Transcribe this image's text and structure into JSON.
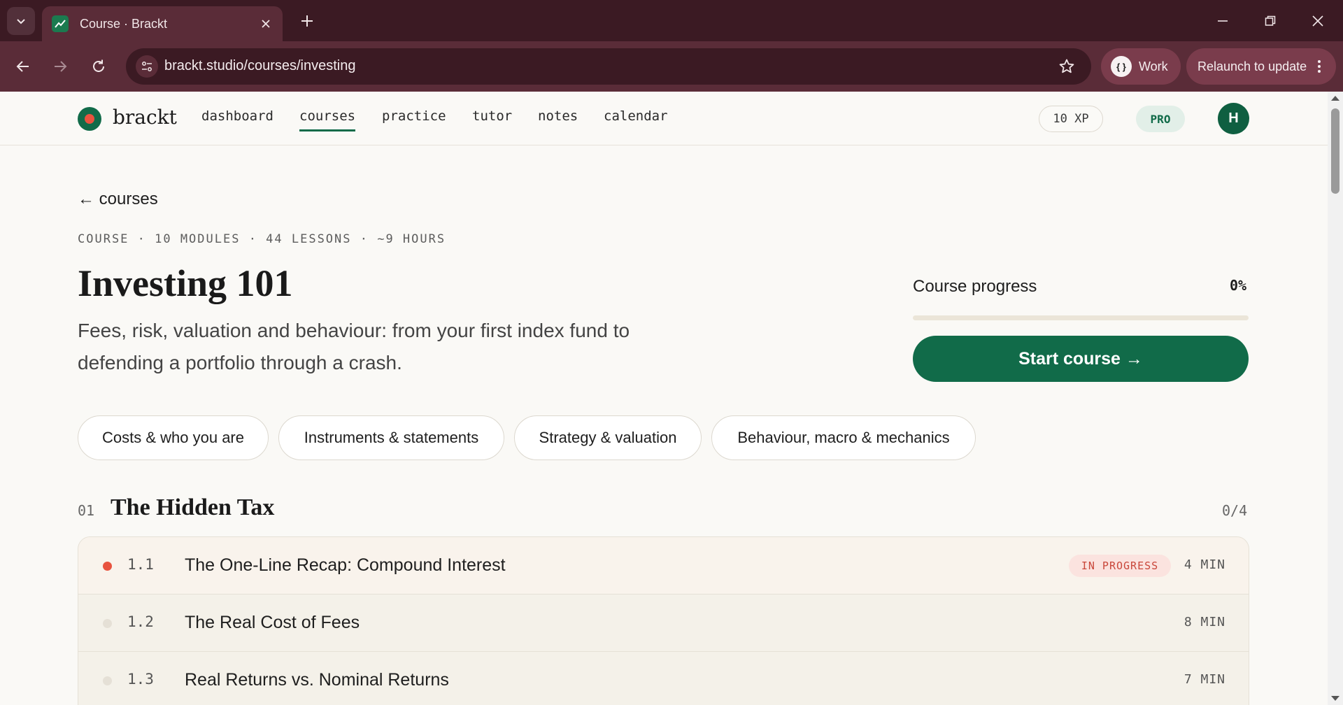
{
  "browser": {
    "tab_title": "Course · Brackt",
    "url": "brackt.studio/courses/investing",
    "profile_label": "Work",
    "relaunch_label": "Relaunch to update"
  },
  "app": {
    "logo_text": "brackt",
    "nav": [
      {
        "label": "dashboard"
      },
      {
        "label": "courses"
      },
      {
        "label": "practice"
      },
      {
        "label": "tutor"
      },
      {
        "label": "notes"
      },
      {
        "label": "calendar"
      }
    ],
    "active_nav": "courses",
    "xp": "10 XP",
    "plan": "PRO",
    "avatar_initial": "H"
  },
  "course": {
    "back_label": "← courses",
    "meta": "COURSE · 10 MODULES · 44 LESSONS · ~9 HOURS",
    "title": "Investing 101",
    "description": "Fees, risk, valuation and behaviour: from your first index fund to defending a portfolio through a crash.",
    "progress_label": "Course progress",
    "progress_value": "0%",
    "progress_fraction": 0,
    "start_label": "Start course →"
  },
  "filters": [
    {
      "label": "Costs & who you are"
    },
    {
      "label": "Instruments & statements"
    },
    {
      "label": "Strategy & valuation"
    },
    {
      "label": "Behaviour, macro & mechanics"
    }
  ],
  "module": {
    "number": "01",
    "title": "The Hidden Tax",
    "count": "0/4",
    "lessons": [
      {
        "num": "1.1",
        "title": "The One-Line Recap: Compound Interest",
        "badge": "IN PROGRESS",
        "duration": "4 MIN",
        "status": "in-progress"
      },
      {
        "num": "1.2",
        "title": "The Real Cost of Fees",
        "badge": "",
        "duration": "8 MIN",
        "status": "not-started"
      },
      {
        "num": "1.3",
        "title": "Real Returns vs. Nominal Returns",
        "badge": "",
        "duration": "7 MIN",
        "status": "not-started"
      }
    ]
  },
  "colors": {
    "brand_green": "#116b49",
    "accent_coral": "#e8533f",
    "browser_frame": "#5a2c38"
  },
  "icons": [
    "tab-search-icon",
    "chart-favicon-icon",
    "close-icon",
    "plus-icon",
    "minimize-icon",
    "restore-icon",
    "back-arrow-icon",
    "forward-arrow-icon",
    "reload-icon",
    "site-settings-icon",
    "star-icon",
    "kebab-menu-icon"
  ]
}
